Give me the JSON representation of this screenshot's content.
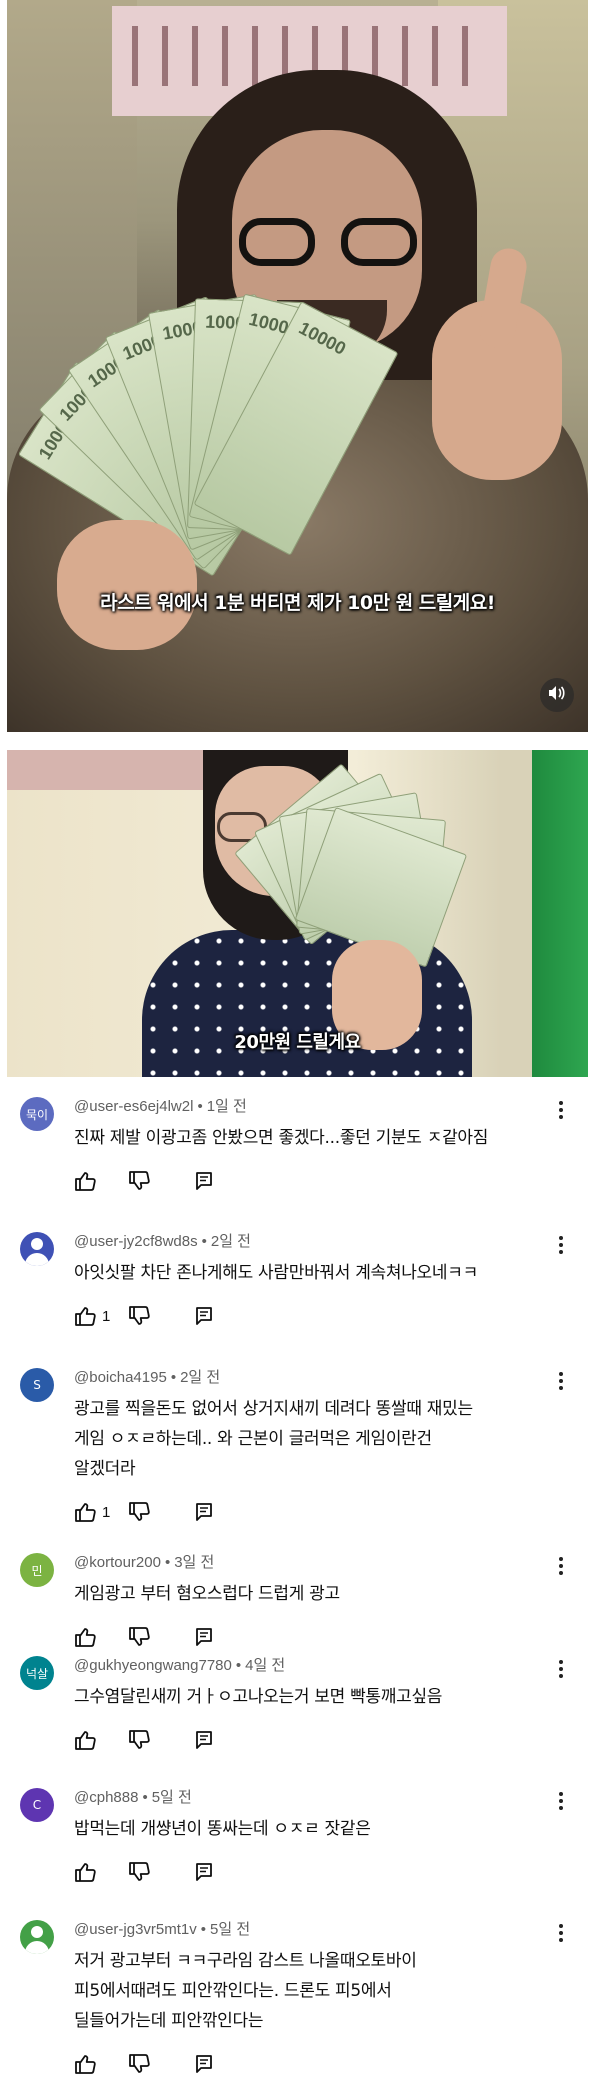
{
  "frame1": {
    "subtitle": "라스트 워에서 1분 버티면 제가 10만 원 드릴게요!",
    "volume_icon": "speaker-icon"
  },
  "frame2": {
    "subtitle": "20만원 드릴게요"
  },
  "comments": [
    {
      "avatar_text": "묵이",
      "avatar_color": "#5c6bc0",
      "user": "@user-es6ej4lw2l",
      "time": "1일 전",
      "lines": [
        "진짜 제발 이광고좀 안봤으면 좋겠다...좋던 기분도 ㅈ같아짐"
      ],
      "likes": ""
    },
    {
      "avatar_text": "",
      "avatar_color": "#3f51b5",
      "user": "@user-jy2cf8wd8s",
      "time": "2일 전",
      "lines": [
        "아잇싯팔 차단 존나게해도 사람만바꿔서 계속쳐나오네ㅋㅋ"
      ],
      "likes": "1"
    },
    {
      "avatar_text": "S",
      "avatar_color": "#2a5ba8",
      "user": "@boicha4195",
      "time": "2일 전",
      "lines": [
        "광고를 찍을돈도 없어서 상거지새끼 데려다 똥쌀때 재밌는",
        "게임 ㅇㅈㄹ하는데.. 와 근본이 글러먹은 게임이란건",
        "알겠더라"
      ],
      "likes": "1"
    },
    {
      "avatar_text": "민",
      "avatar_color": "#7cb342",
      "user": "@kortour200",
      "time": "3일 전",
      "lines": [
        "게임광고 부터 혐오스럽다 드럽게 광고"
      ],
      "likes": ""
    },
    {
      "avatar_text": "넉살",
      "avatar_color": "#00838f",
      "user": "@gukhyeongwang7780",
      "time": "4일 전",
      "lines": [
        "그수염달린새끼 거ㅏㅇ고나오는거 보면 빡통깨고싶음"
      ],
      "likes": ""
    },
    {
      "avatar_text": "C",
      "avatar_color": "#5e35b1",
      "user": "@cph888",
      "time": "5일 전",
      "lines": [
        "밥먹는데 개썅년이 똥싸는데 ㅇㅈㄹ 잣같은"
      ],
      "likes": ""
    },
    {
      "avatar_text": "",
      "avatar_color": "#43a047",
      "user": "@user-jg3vr5mt1v",
      "time": "5일 전",
      "lines": [
        "저거 광고부터 ㅋㅋ구라임 감스트 나올때오토바이",
        "피5에서때려도 피안깎인다는. 드론도 피5에서",
        "딜들어가는데 피안깎인다는"
      ],
      "likes": ""
    }
  ],
  "icons": {
    "like": "thumbs-up-icon",
    "dislike": "thumbs-down-icon",
    "reply": "reply-icon",
    "more": "more-vert-icon"
  }
}
